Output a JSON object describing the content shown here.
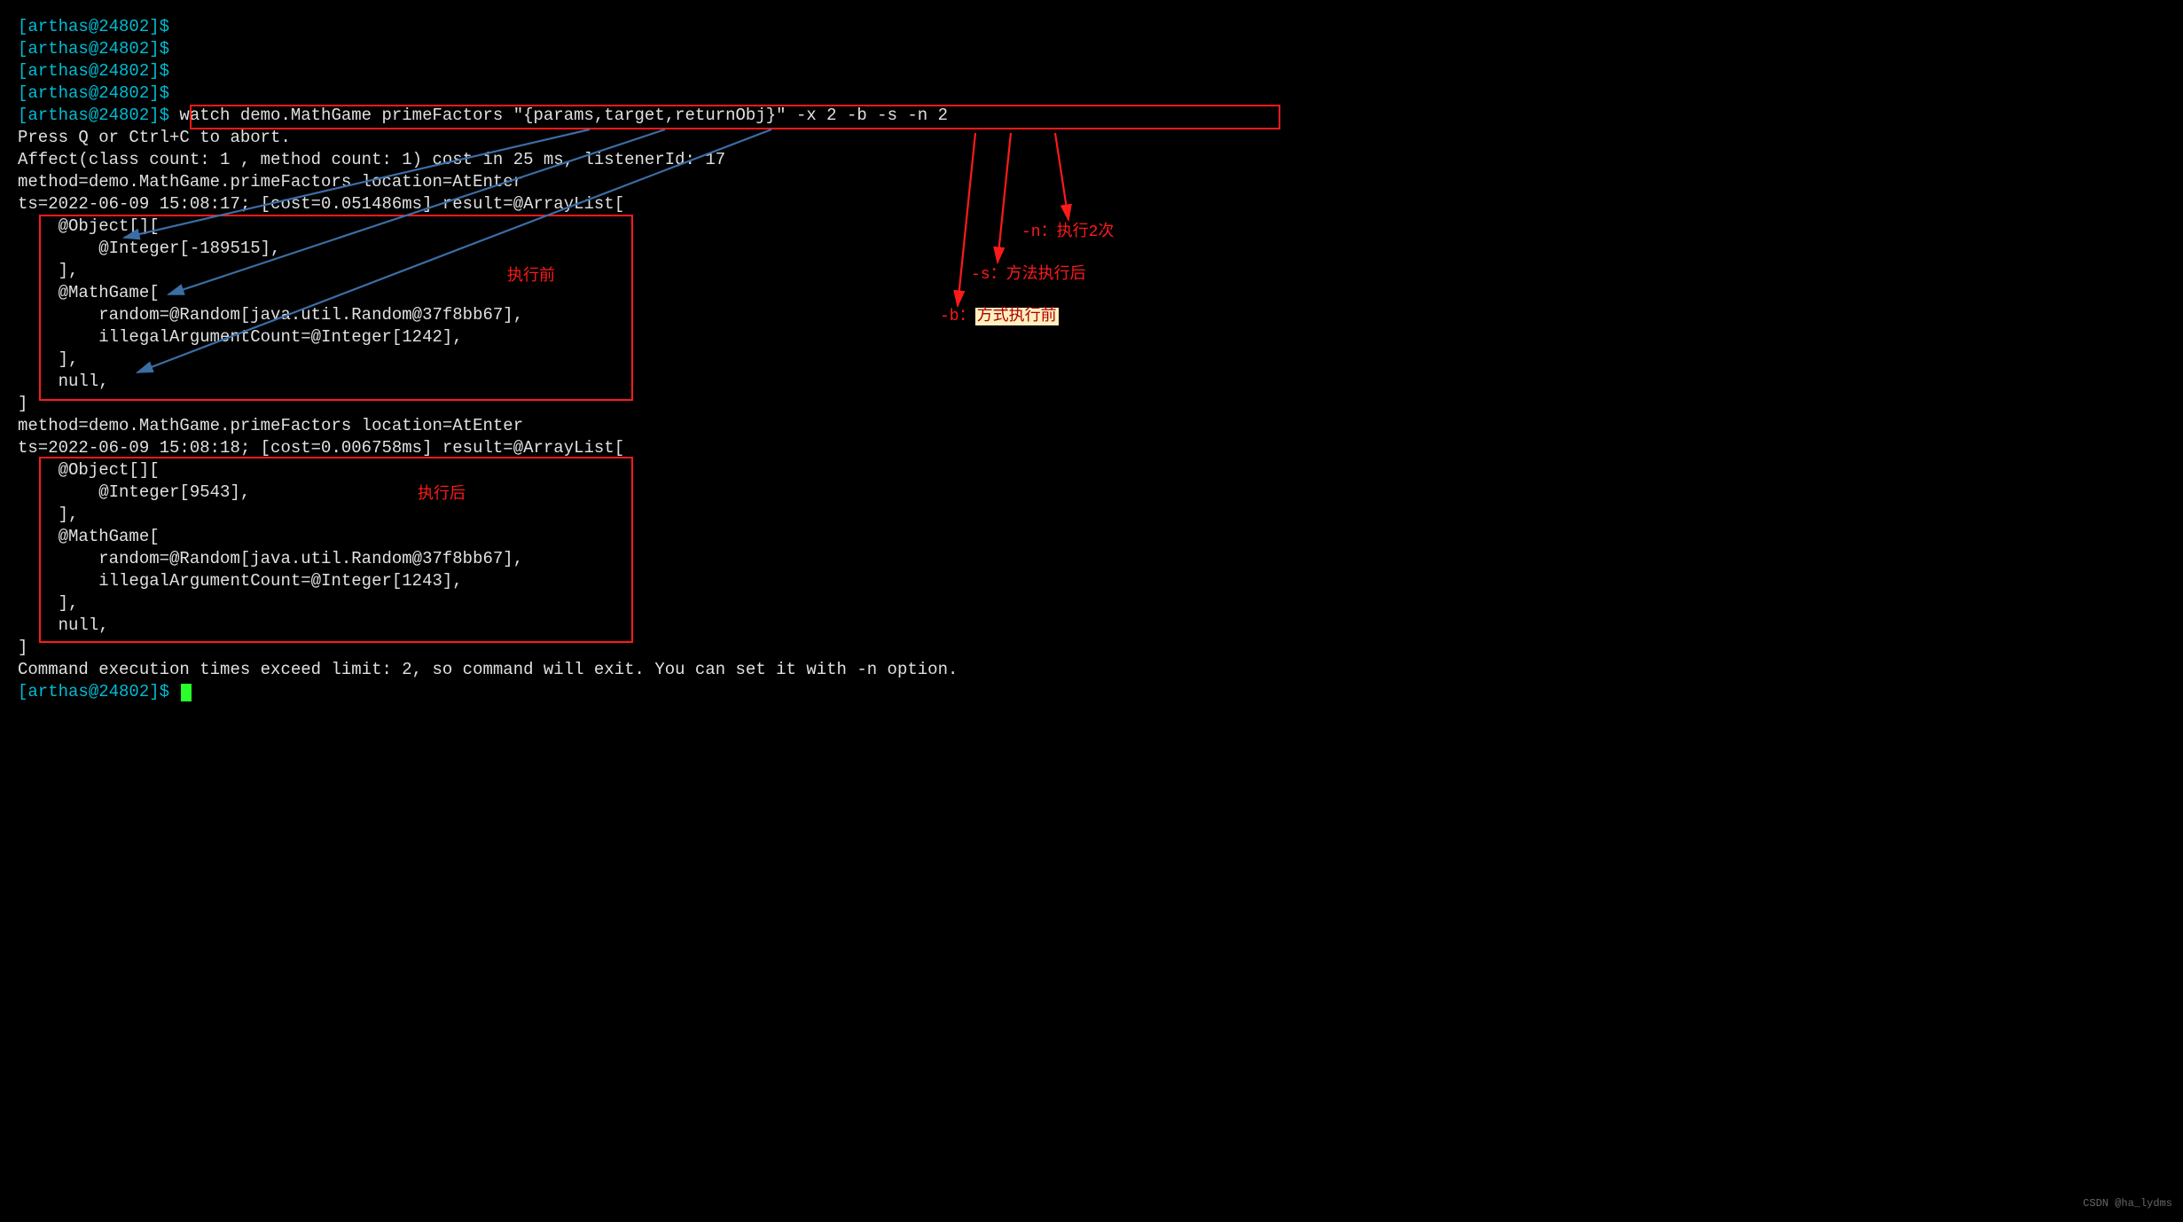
{
  "prompt": "[arthas@24802]$",
  "blanks": [
    "",
    "",
    "",
    ""
  ],
  "cmd": " watch demo.MathGame primeFactors \"{params,target,returnObj}\" -x 2 -b -s -n 2",
  "abort": "Press Q or Ctrl+C to abort.",
  "affect": "Affect(class count: 1 , method count: 1) cost in 25 ms, listenerId: 17",
  "inv1": {
    "method": "method=demo.MathGame.primeFactors location=AtEnter",
    "ts": "ts=2022-06-09 15:08:17; [cost=0.051486ms] result=@ArrayList[",
    "l1": "    @Object[][",
    "l2": "        @Integer[-189515],",
    "l3": "    ],",
    "l4": "    @MathGame[",
    "l5": "        random=@Random[java.util.Random@37f8bb67],",
    "l6": "        illegalArgumentCount=@Integer[1242],",
    "l7": "    ],",
    "l8": "    null,",
    "end": "]"
  },
  "inv2": {
    "method": "method=demo.MathGame.primeFactors location=AtEnter",
    "ts": "ts=2022-06-09 15:08:18; [cost=0.006758ms] result=@ArrayList[",
    "l1": "    @Object[][",
    "l2": "        @Integer[9543],",
    "l3": "    ],",
    "l4": "    @MathGame[",
    "l5": "        random=@Random[java.util.Random@37f8bb67],",
    "l6": "        illegalArgumentCount=@Integer[1243],",
    "l7": "    ],",
    "l8": "    null,",
    "end": "]"
  },
  "exit": "Command execution times exceed limit: 2, so command will exit. You can set it with -n option.",
  "labels": {
    "before": "执行前",
    "after": "执行后",
    "n": "-n：执行2次",
    "s": "-s：方法执行后",
    "b_prefix": "-b：",
    "b_hl": "方式执行前"
  },
  "watermark": "CSDN @ha_lydms",
  "colors": {
    "prompt": "#00bcd4",
    "text": "#cfcfcf",
    "red": "#ff1a1a",
    "cursor": "#2aff2a"
  }
}
